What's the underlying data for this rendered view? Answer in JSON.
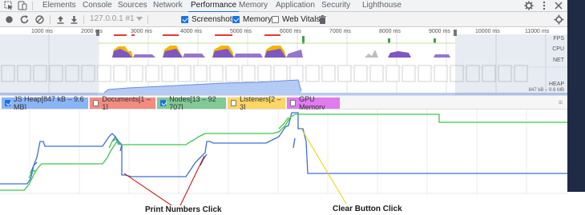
{
  "tabs": {
    "items": [
      {
        "label": "Elements"
      },
      {
        "label": "Console"
      },
      {
        "label": "Sources"
      },
      {
        "label": "Network"
      },
      {
        "label": "Performance"
      },
      {
        "label": "Memory"
      },
      {
        "label": "Application"
      },
      {
        "label": "Security"
      },
      {
        "label": "Lighthouse"
      }
    ],
    "active": "Performance"
  },
  "toolbar": {
    "url": "127.0.0.1 #1",
    "screenshots_label": "Screenshots",
    "screenshots_checked": true,
    "memory_label": "Memory",
    "memory_checked": true,
    "webvitals_label": "Web Vitals",
    "webvitals_checked": false
  },
  "overview": {
    "ticks": [
      "1000 ms",
      "2000 ms",
      "3000 ms",
      "4000 ms",
      "5000 ms",
      "6000 ms",
      "7000 ms",
      "8000 ms",
      "9000 ms",
      "10000 ms",
      "11000 ms"
    ],
    "tracks": [
      "FPS",
      "CPU",
      "NET",
      "HEAP"
    ],
    "heap_range": "847 kB – 9.6 MB"
  },
  "counters": {
    "items": [
      {
        "label": "JS Heap[847 kB – 9.6 MB]",
        "checked": true,
        "color": "#8ab4f8"
      },
      {
        "label": "Documents[1 – 1]",
        "checked": false,
        "color": "#f28b82"
      },
      {
        "label": "Nodes[13 – 92 707]",
        "checked": true,
        "color": "#81c995"
      },
      {
        "label": "Listeners[2 – 3]",
        "checked": false,
        "color": "#fdd663"
      },
      {
        "label": "GPU Memory",
        "checked": false,
        "color": "#e07bf0"
      }
    ]
  },
  "annotations": {
    "print_numbers": "Print Numbers Click",
    "clear_button": "Clear Button Click"
  }
}
